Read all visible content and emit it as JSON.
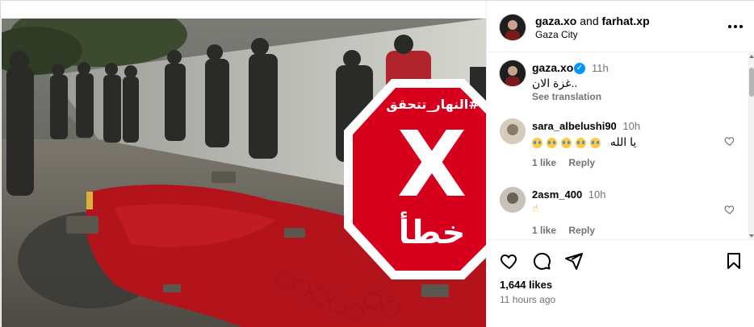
{
  "post": {
    "author": "gaza.xo",
    "and": "and",
    "collaborator": "farhat.xp",
    "location": "Gaza City"
  },
  "overlay": {
    "hashtag": "#النهار_تتحقق",
    "mark": "X",
    "verdict": "خطأ",
    "color": "#d6001c"
  },
  "comments": [
    {
      "username": "gaza.xo",
      "verified": true,
      "time": "11h",
      "text": "غزة الان..",
      "see_translation": "See translation"
    },
    {
      "username": "sara_albelushi90",
      "time": "10h",
      "text": "يا الله",
      "emoji": "crying-face-icon",
      "emoji_count": 5,
      "likes": "1 like",
      "reply": "Reply"
    },
    {
      "username": "2asm_400",
      "time": "10h",
      "text": "☝",
      "likes": "1 like",
      "reply": "Reply"
    }
  ],
  "stats": {
    "likes": "1,644 likes",
    "time_ago": "11 hours ago"
  },
  "colors": {
    "verified": "#0095f6",
    "muted": "#737373",
    "blood": "#b3141c"
  }
}
